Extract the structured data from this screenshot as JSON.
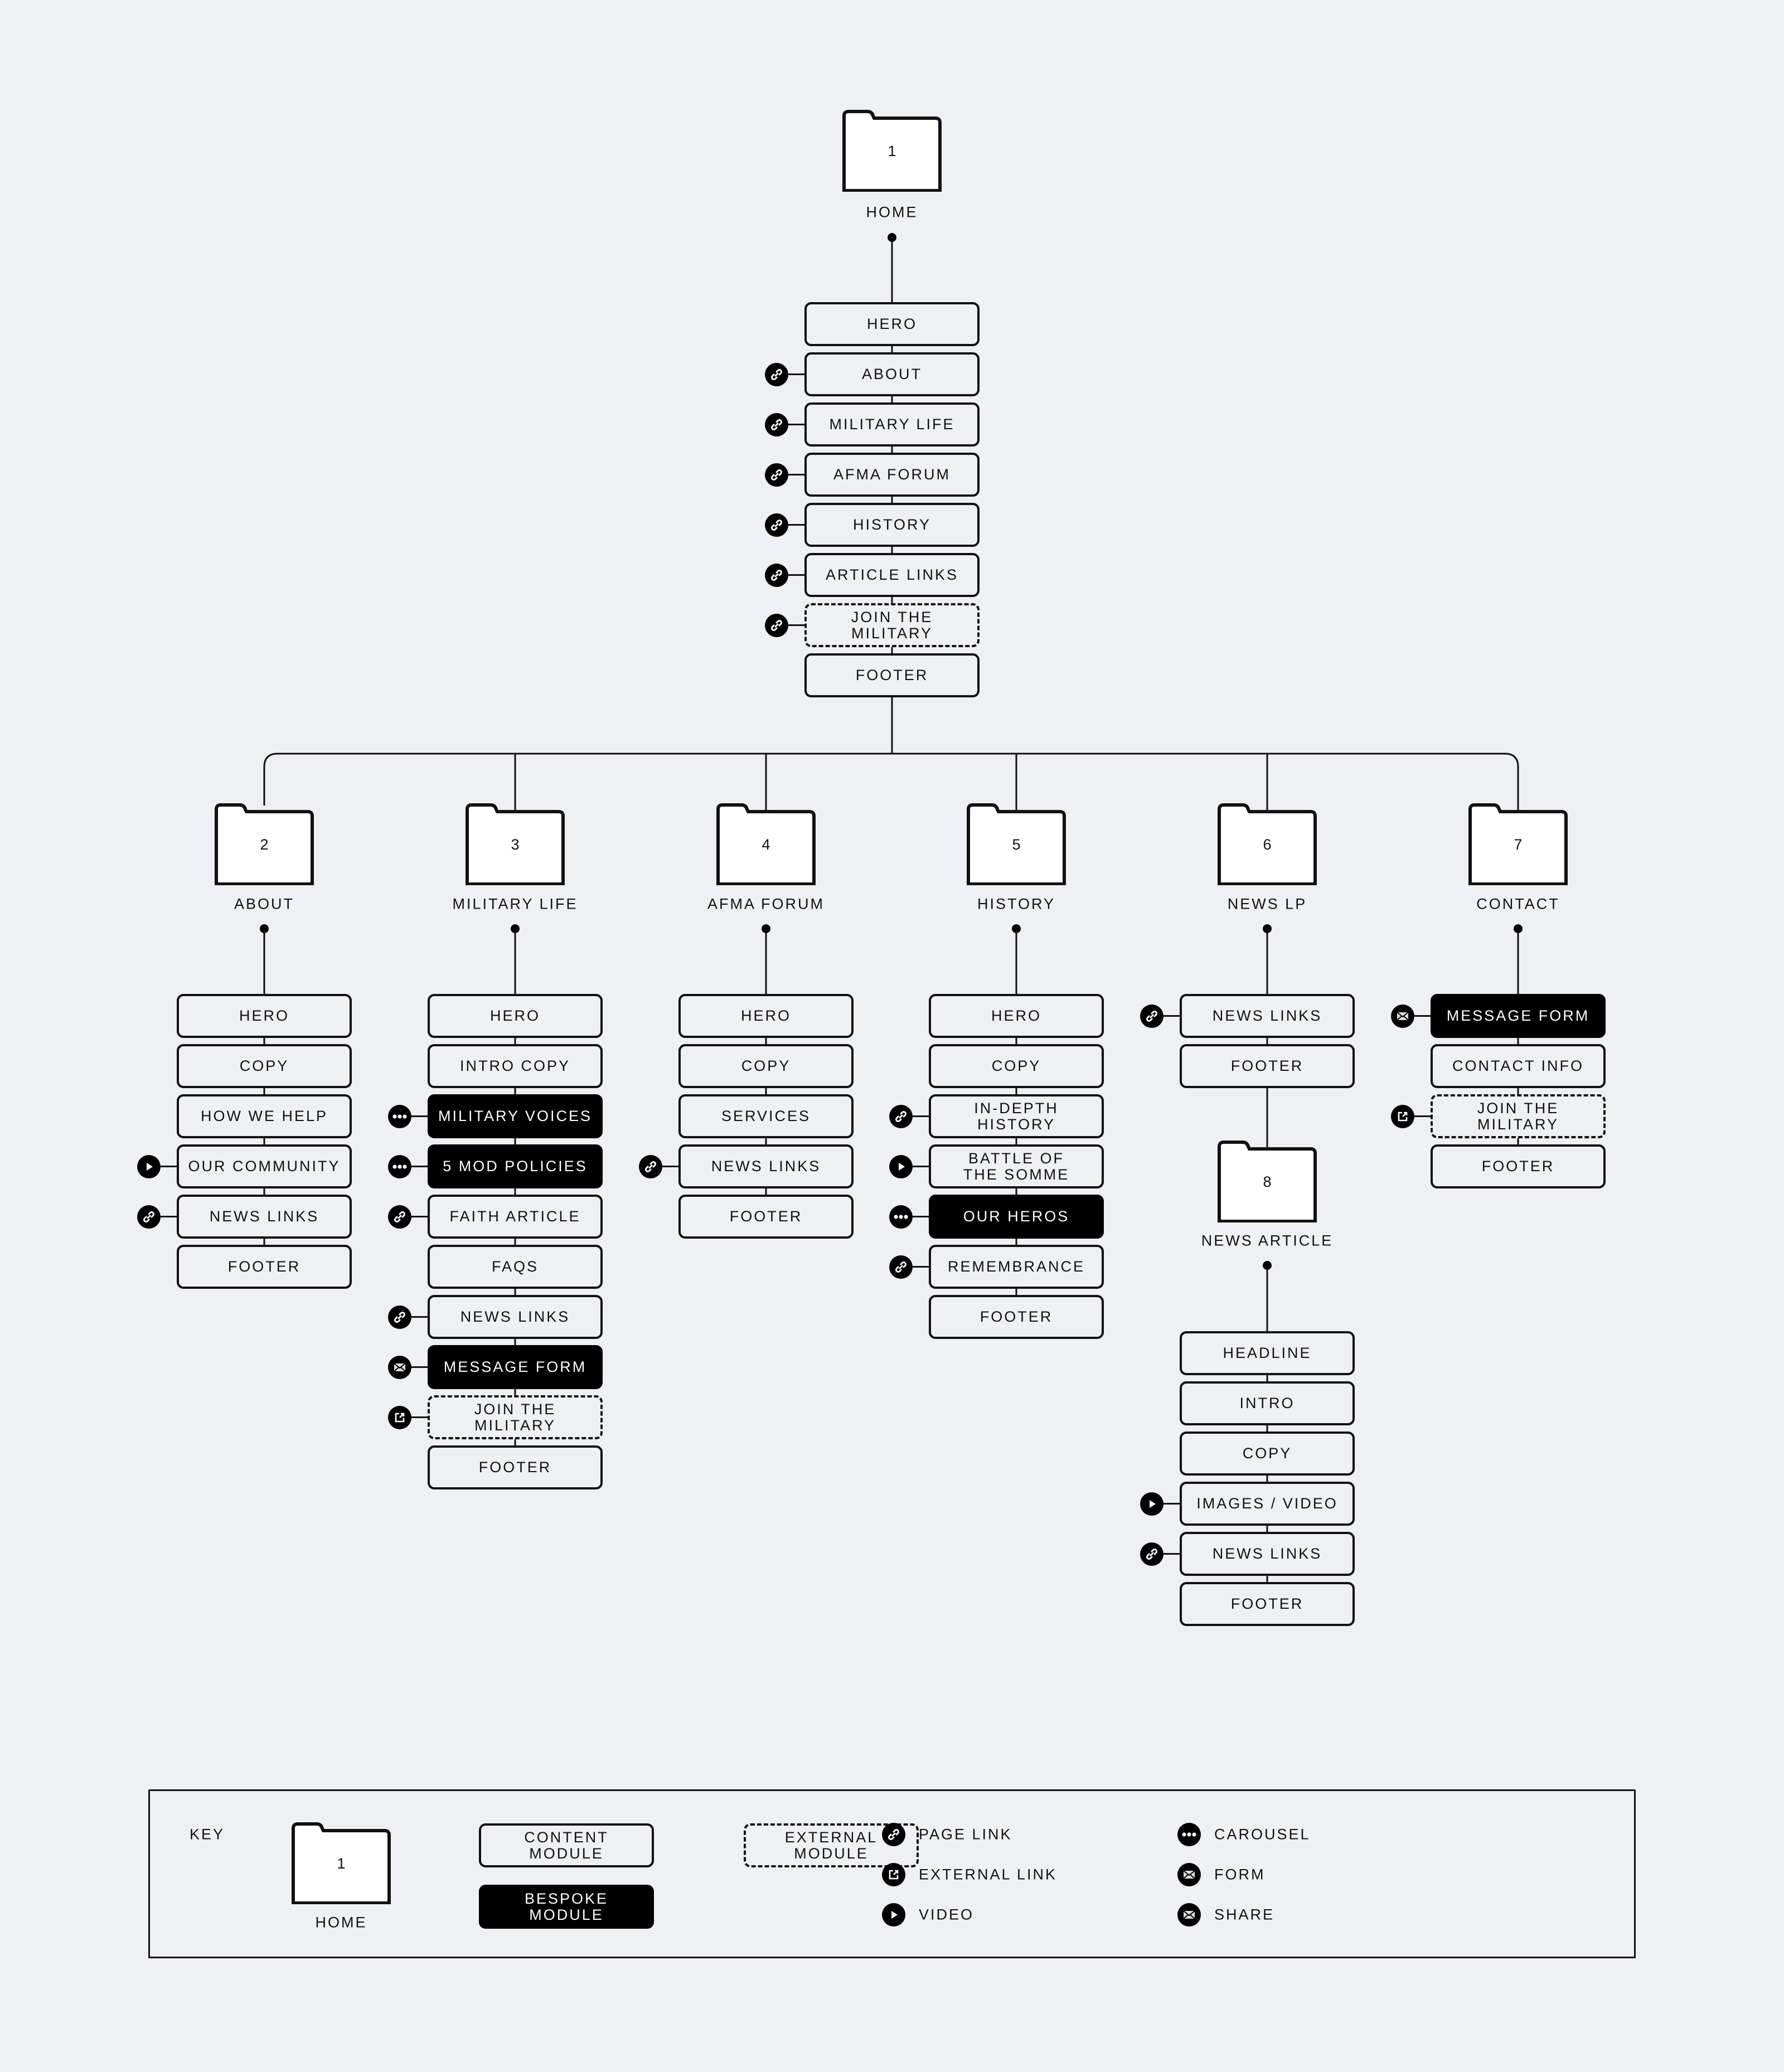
{
  "colors": {
    "background": "#eff0f4",
    "line": "#111111",
    "bespoke_fill": "#000000",
    "bespoke_text": "#ffffff"
  },
  "root": {
    "number": "1",
    "label": "HOME",
    "modules": [
      {
        "label": "HERO",
        "type": "content",
        "icon": null
      },
      {
        "label": "ABOUT",
        "type": "content",
        "icon": "page-link"
      },
      {
        "label": "MILITARY LIFE",
        "type": "content",
        "icon": "page-link"
      },
      {
        "label": "AFMA FORUM",
        "type": "content",
        "icon": "page-link"
      },
      {
        "label": "HISTORY",
        "type": "content",
        "icon": "page-link"
      },
      {
        "label": "ARTICLE LINKS",
        "type": "content",
        "icon": "page-link"
      },
      {
        "label": "JOIN THE MILITARY",
        "type": "external",
        "icon": "page-link"
      },
      {
        "label": "FOOTER",
        "type": "content",
        "icon": null
      }
    ]
  },
  "pages": [
    {
      "number": "2",
      "label": "ABOUT",
      "modules": [
        {
          "label": "HERO",
          "type": "content",
          "icon": null
        },
        {
          "label": "COPY",
          "type": "content",
          "icon": null
        },
        {
          "label": "HOW WE HELP",
          "type": "content",
          "icon": null
        },
        {
          "label": "OUR COMMUNITY",
          "type": "content",
          "icon": "video"
        },
        {
          "label": "NEWS LINKS",
          "type": "content",
          "icon": "page-link"
        },
        {
          "label": "FOOTER",
          "type": "content",
          "icon": null
        }
      ]
    },
    {
      "number": "3",
      "label": "MILITARY LIFE",
      "modules": [
        {
          "label": "HERO",
          "type": "content",
          "icon": null
        },
        {
          "label": "INTRO COPY",
          "type": "content",
          "icon": null
        },
        {
          "label": "MILITARY VOICES",
          "type": "bespoke",
          "icon": "carousel"
        },
        {
          "label": "5 MOD POLICIES",
          "type": "bespoke",
          "icon": "carousel"
        },
        {
          "label": "FAITH ARTICLE",
          "type": "content",
          "icon": "page-link"
        },
        {
          "label": "FAQS",
          "type": "content",
          "icon": null
        },
        {
          "label": "NEWS LINKS",
          "type": "content",
          "icon": "page-link"
        },
        {
          "label": "MESSAGE FORM",
          "type": "bespoke",
          "icon": "form"
        },
        {
          "label": "JOIN THE MILITARY",
          "type": "external",
          "icon": "external-link"
        },
        {
          "label": "FOOTER",
          "type": "content",
          "icon": null
        }
      ]
    },
    {
      "number": "4",
      "label": "AFMA FORUM",
      "modules": [
        {
          "label": "HERO",
          "type": "content",
          "icon": null
        },
        {
          "label": "COPY",
          "type": "content",
          "icon": null
        },
        {
          "label": "SERVICES",
          "type": "content",
          "icon": null
        },
        {
          "label": "NEWS LINKS",
          "type": "content",
          "icon": "page-link"
        },
        {
          "label": "FOOTER",
          "type": "content",
          "icon": null
        }
      ]
    },
    {
      "number": "5",
      "label": "HISTORY",
      "modules": [
        {
          "label": "HERO",
          "type": "content",
          "icon": null
        },
        {
          "label": "COPY",
          "type": "content",
          "icon": null
        },
        {
          "label": "IN-DEPTH HISTORY",
          "type": "content",
          "icon": "page-link"
        },
        {
          "label": "BATTLE OF THE SOMME",
          "type": "content",
          "icon": "video"
        },
        {
          "label": "OUR HEROS",
          "type": "bespoke",
          "icon": "carousel"
        },
        {
          "label": "REMEMBRANCE",
          "type": "content",
          "icon": "page-link"
        },
        {
          "label": "FOOTER",
          "type": "content",
          "icon": null
        }
      ]
    },
    {
      "number": "6",
      "label": "NEWS LP",
      "modules": [
        {
          "label": "NEWS LINKS",
          "type": "content",
          "icon": "page-link"
        },
        {
          "label": "FOOTER",
          "type": "content",
          "icon": null
        }
      ],
      "child": {
        "number": "8",
        "label": "NEWS ARTICLE",
        "modules": [
          {
            "label": "HEADLINE",
            "type": "content",
            "icon": null
          },
          {
            "label": "INTRO",
            "type": "content",
            "icon": null
          },
          {
            "label": "COPY",
            "type": "content",
            "icon": null
          },
          {
            "label": "IMAGES / VIDEO",
            "type": "content",
            "icon": "video"
          },
          {
            "label": "NEWS LINKS",
            "type": "content",
            "icon": "page-link"
          },
          {
            "label": "FOOTER",
            "type": "content",
            "icon": null
          }
        ]
      }
    },
    {
      "number": "7",
      "label": "CONTACT",
      "modules": [
        {
          "label": "MESSAGE FORM",
          "type": "bespoke",
          "icon": "form"
        },
        {
          "label": "CONTACT INFO",
          "type": "content",
          "icon": null
        },
        {
          "label": "JOIN THE MILITARY",
          "type": "external",
          "icon": "external-link"
        },
        {
          "label": "FOOTER",
          "type": "content",
          "icon": null
        }
      ]
    }
  ],
  "legend": {
    "title": "KEY",
    "folder_number": "1",
    "folder_label": "HOME",
    "content_module": "CONTENT MODULE",
    "bespoke_module": "BESPOKE MODULE",
    "external_module": "EXTERNAL MODULE",
    "icons": [
      {
        "icon": "page-link",
        "label": "PAGE LINK"
      },
      {
        "icon": "external-link",
        "label": "EXTERNAL LINK"
      },
      {
        "icon": "video",
        "label": "VIDEO"
      },
      {
        "icon": "carousel",
        "label": "CAROUSEL"
      },
      {
        "icon": "form",
        "label": "FORM"
      },
      {
        "icon": "share",
        "label": "SHARE"
      }
    ]
  }
}
